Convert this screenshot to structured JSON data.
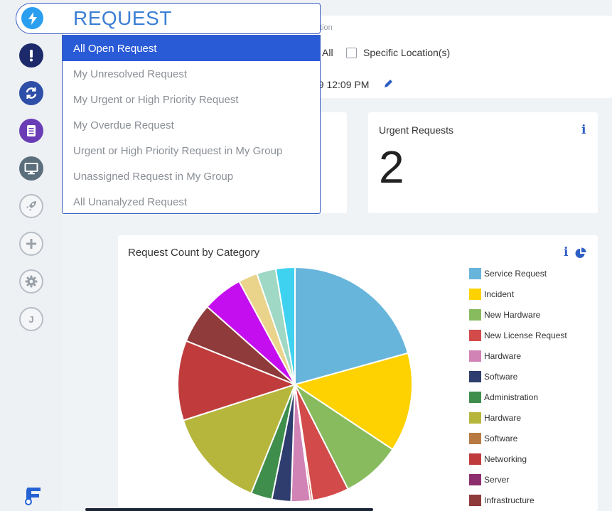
{
  "sidebar": {
    "items": [
      {
        "name": "request",
        "icon": "lightning-icon",
        "color": "#2a9ff0"
      },
      {
        "name": "problem",
        "icon": "exclamation-icon",
        "color": "#1c2a6b"
      },
      {
        "name": "change",
        "icon": "refresh-icon",
        "color": "#2d4fa8"
      },
      {
        "name": "knowledge",
        "icon": "book-icon",
        "color": "#6a3db6"
      },
      {
        "name": "assets",
        "icon": "monitor-icon",
        "color": "#5b6e7c"
      },
      {
        "name": "release",
        "icon": "rocket-icon"
      },
      {
        "name": "create",
        "icon": "plus-icon"
      },
      {
        "name": "settings",
        "icon": "gear-icon"
      },
      {
        "name": "user",
        "icon": "user-initial-icon",
        "label": "J"
      }
    ]
  },
  "dropdown": {
    "title": "REQUEST",
    "options": [
      "All Open Request",
      "My Unresolved Request",
      "My Urgent or High Priority Request",
      "My Overdue Request",
      "Urgent or High Priority Request in My Group",
      "Unassigned Request in My Group",
      "All Unanalyzed Request"
    ],
    "selected": "All Open Request"
  },
  "filters": {
    "location_label_partial": "tion",
    "option_all": "All",
    "option_specific": "Specific Location(s)",
    "datetime_partial": "19 12:09 PM"
  },
  "widgets": {
    "urgent": {
      "title": "Urgent Requests",
      "count": "2"
    }
  },
  "chart": {
    "title": "Request Count by Category"
  },
  "chart_data": {
    "type": "pie",
    "title": "Request Count by Category",
    "legend_position": "right",
    "slices": [
      {
        "label": "Service Request",
        "value": 21.2,
        "color": "#67b5db"
      },
      {
        "label": "Incident",
        "value": 14.0,
        "color": "#fdd200"
      },
      {
        "label": "New Hardware",
        "value": 8.4,
        "color": "#87bb5e"
      },
      {
        "label": "New License Request",
        "value": 5.2,
        "color": "#d24a49"
      },
      {
        "label": "Hardware",
        "value": 0.3,
        "color": "#d4453f"
      },
      {
        "label": "Hardware",
        "value": 2.7,
        "color": "#d183b6"
      },
      {
        "label": "Software",
        "value": 2.7,
        "color": "#2e3d6e"
      },
      {
        "label": "Administration",
        "value": 3.0,
        "color": "#3f8e4c"
      },
      {
        "label": "Hardware",
        "value": 14.3,
        "color": "#b6b63c"
      },
      {
        "label": "Networking",
        "value": 11.3,
        "color": "#c03c3c"
      },
      {
        "label": "Infrastructure",
        "value": 5.6,
        "color": "#8f3a3b"
      },
      {
        "label": "",
        "value": 5.7,
        "color": "#c40ef0"
      },
      {
        "label": "",
        "value": 2.7,
        "color": "#ead48b"
      },
      {
        "label": "",
        "value": 2.7,
        "color": "#9fd8c4"
      },
      {
        "label": "",
        "value": 2.7,
        "color": "#3fd2f0"
      }
    ],
    "legend": [
      {
        "label": "Service Request",
        "color": "#67b5db"
      },
      {
        "label": "Incident",
        "color": "#fdd200"
      },
      {
        "label": "New Hardware",
        "color": "#87bb5e"
      },
      {
        "label": "New License Request",
        "color": "#d24a49"
      },
      {
        "label": "Hardware",
        "color": "#d183b6"
      },
      {
        "label": "Software",
        "color": "#2e3d6e"
      },
      {
        "label": "Administration",
        "color": "#3f8e4c"
      },
      {
        "label": "Hardware",
        "color": "#b6b63c"
      },
      {
        "label": "Software",
        "color": "#b87a42"
      },
      {
        "label": "Networking",
        "color": "#c03c3c"
      },
      {
        "label": "Server",
        "color": "#8c2f6e"
      },
      {
        "label": "Infrastructure",
        "color": "#8f3a3b"
      }
    ]
  }
}
